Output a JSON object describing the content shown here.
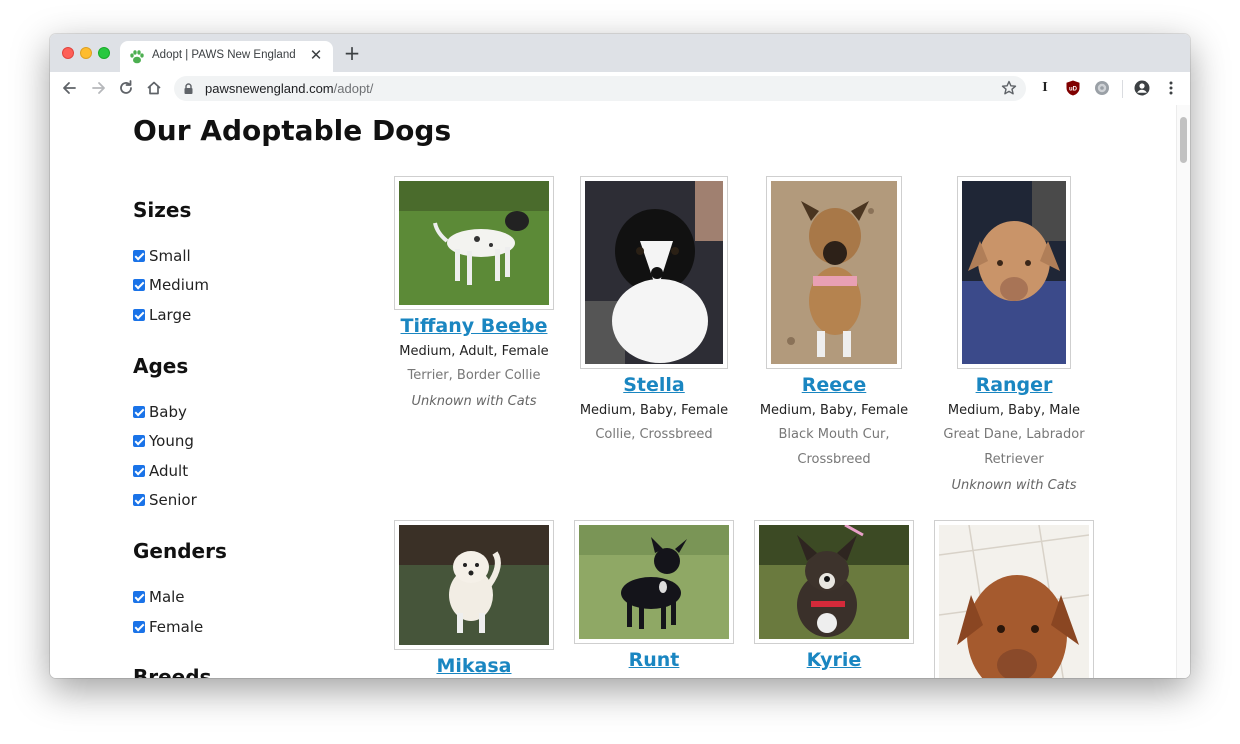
{
  "browser": {
    "tab_title": "Adopt | PAWS New England",
    "tab_close": "✕",
    "new_tab": "+",
    "url_domain": "pawsnewengland.com",
    "url_path": "/adopt/",
    "ext_i_label": "I",
    "ext_ublock_label": "uD"
  },
  "page": {
    "title": "Our Adoptable Dogs"
  },
  "filters": {
    "sizes": {
      "heading": "Sizes",
      "options": [
        "Small",
        "Medium",
        "Large"
      ]
    },
    "ages": {
      "heading": "Ages",
      "options": [
        "Baby",
        "Young",
        "Adult",
        "Senior"
      ]
    },
    "genders": {
      "heading": "Genders",
      "options": [
        "Male",
        "Female"
      ]
    },
    "breeds": {
      "heading": "Breeds"
    }
  },
  "dogs": [
    {
      "name": "Tiffany Beebe",
      "meta": "Medium, Adult, Female",
      "breed": "Terrier, Border Collie",
      "note": "Unknown with Cats"
    },
    {
      "name": "Stella",
      "meta": "Medium, Baby, Female",
      "breed": "Collie, Crossbreed"
    },
    {
      "name": "Reece",
      "meta": "Medium, Baby, Female",
      "breed": "Black Mouth Cur, Crossbreed"
    },
    {
      "name": "Ranger",
      "meta": "Medium, Baby, Male",
      "breed": "Great Dane, Labrador Retriever",
      "note": "Unknown with Cats"
    },
    {
      "name": "Mikasa"
    },
    {
      "name": "Runt"
    },
    {
      "name": "Kyrie"
    },
    {
      "name": ""
    }
  ],
  "colors": {
    "link": "#1a86c1",
    "checkbox": "#1a73e8",
    "paw_icon": "#4caf50"
  }
}
